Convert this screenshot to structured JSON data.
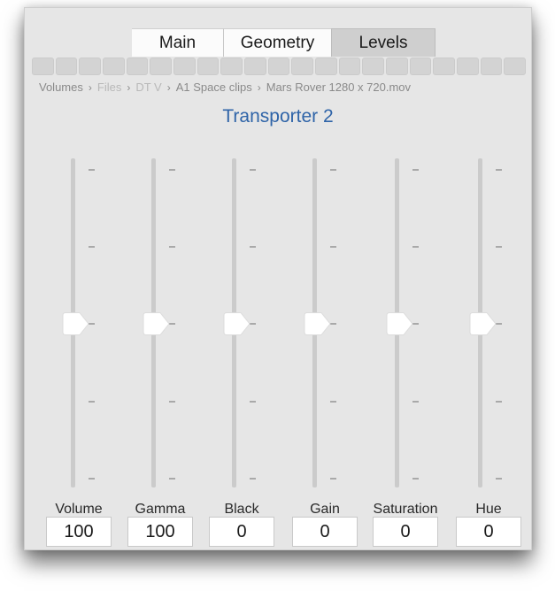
{
  "tabs": [
    {
      "label": "Main",
      "selected": false
    },
    {
      "label": "Geometry",
      "selected": false
    },
    {
      "label": "Levels",
      "selected": true
    }
  ],
  "breadcrumb": [
    {
      "label": "Volumes",
      "faded": false
    },
    {
      "label": "Files",
      "faded": true
    },
    {
      "label": "DT V",
      "faded": true
    },
    {
      "label": "A1 Space clips",
      "faded": false
    },
    {
      "label": "Mars Rover 1280 x 720.mov",
      "faded": false
    }
  ],
  "breadcrumb_separator": "›",
  "title": "Transporter 2",
  "title_color": "#2f64a8",
  "sliders": [
    {
      "label": "Volume",
      "value": "100",
      "position_fraction": 0.5
    },
    {
      "label": "Gamma",
      "value": "100",
      "position_fraction": 0.5
    },
    {
      "label": "Black",
      "value": "0",
      "position_fraction": 0.5
    },
    {
      "label": "Gain",
      "value": "0",
      "position_fraction": 0.5
    },
    {
      "label": "Saturation",
      "value": "0",
      "position_fraction": 0.5
    },
    {
      "label": "Hue",
      "value": "0",
      "position_fraction": 0.5
    }
  ],
  "tick_count": 5
}
